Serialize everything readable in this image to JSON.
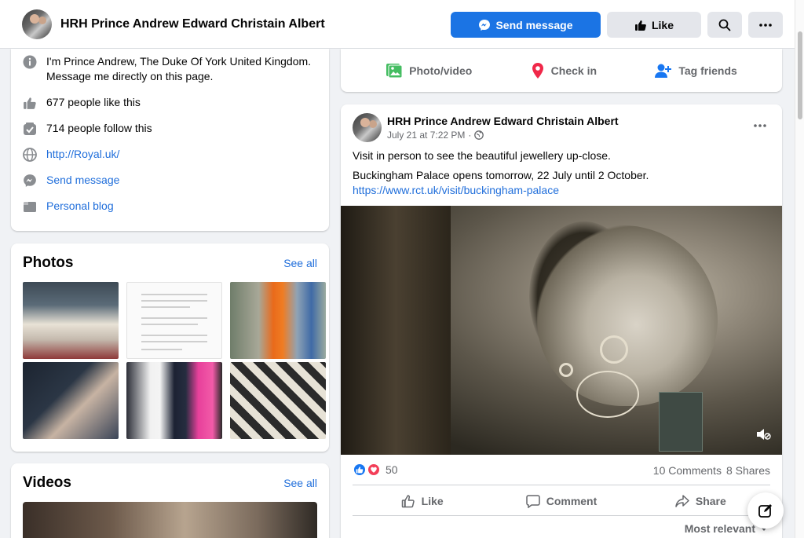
{
  "header": {
    "page_name": "HRH Prince Andrew Edward Christain Albert",
    "send_message_label": "Send message",
    "like_label": "Like",
    "icons": [
      "messenger-icon",
      "thumbs-up-icon",
      "search-icon",
      "more-icon"
    ]
  },
  "intro": {
    "bio": "I'm Prince Andrew, The Duke Of York United Kingdom. Message me directly on this page.",
    "likes": "677 people like this",
    "follows": "714 people follow this",
    "website": "http://Royal.uk/",
    "send_message": "Send message",
    "blog": "Personal blog"
  },
  "photos": {
    "title": "Photos",
    "see_all": "See all"
  },
  "videos": {
    "title": "Videos",
    "see_all": "See all"
  },
  "composer": {
    "photo_video": "Photo/video",
    "check_in": "Check in",
    "tag_friends": "Tag friends"
  },
  "post": {
    "author": "HRH Prince Andrew Edward Christain Albert",
    "timestamp": "July 21 at 7:22 PM",
    "meta_sep": "·",
    "line1": "Visit in person to see the beautiful jewellery up-close.",
    "line2": "Buckingham Palace opens tomorrow, 22 July until 2 October.",
    "url": "https://www.rct.uk/visit/buckingham-palace",
    "reaction_count": "50",
    "comments": "10 Comments",
    "shares": "8 Shares",
    "like_label": "Like",
    "comment_label": "Comment",
    "share_label": "Share",
    "sort_label": "Most relevant"
  },
  "colors": {
    "primary": "#1b74e4",
    "link": "#216fdb",
    "muted": "#65676b",
    "background": "#f0f2f5"
  }
}
